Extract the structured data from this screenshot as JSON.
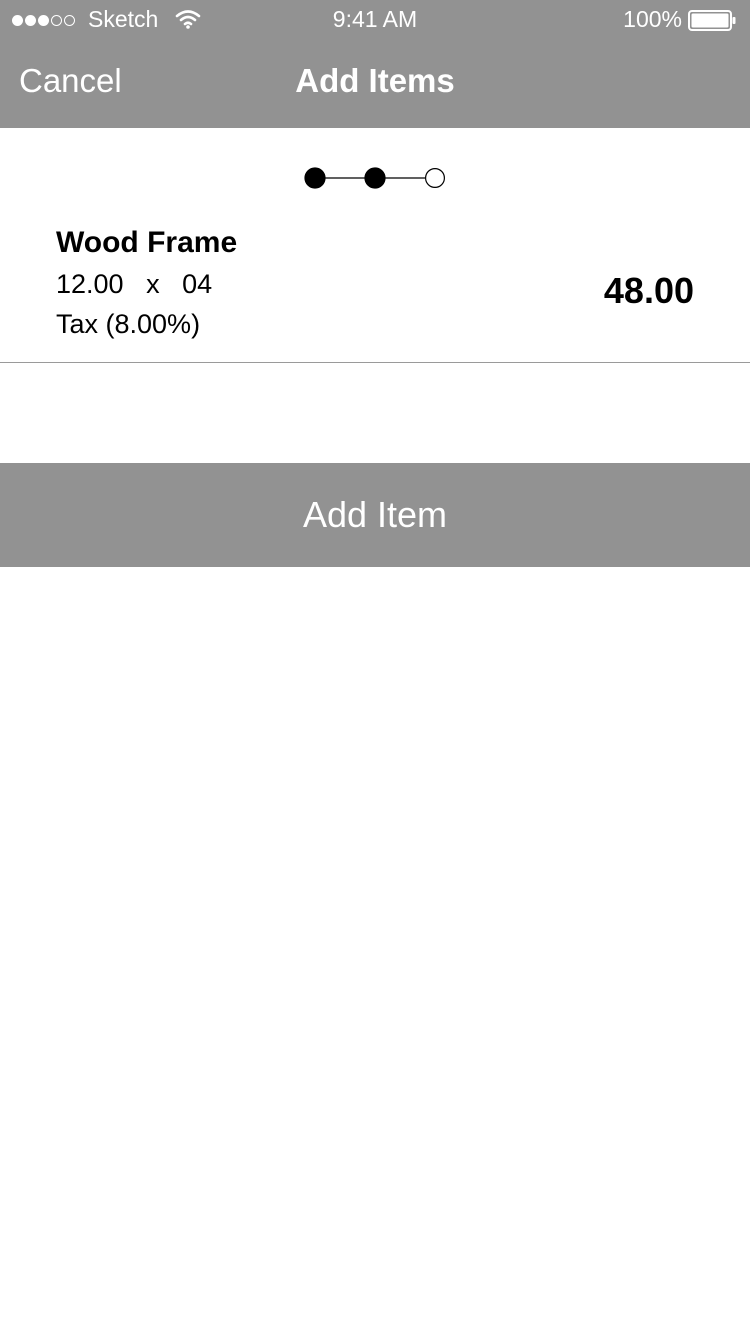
{
  "status_bar": {
    "signal_dots": [
      true,
      true,
      true,
      false,
      false
    ],
    "carrier": "Sketch",
    "time": "9:41 AM",
    "battery_percent": "100%",
    "battery_level": 1.0
  },
  "nav": {
    "cancel_label": "Cancel",
    "title": "Add Items"
  },
  "stepper": {
    "steps": 3,
    "completed": 2
  },
  "item": {
    "name": "Wood Frame",
    "quantity_line": "12.00   x   04",
    "tax": "Tax (8.00%)",
    "total": "48.00"
  },
  "actions": {
    "add_item_label": "Add Item"
  },
  "colors": {
    "bar_gray": "#929292",
    "text": "#000000",
    "on_bar": "#ffffff"
  },
  "icons": {
    "wifi": "wifi-icon",
    "battery": "battery-icon"
  }
}
